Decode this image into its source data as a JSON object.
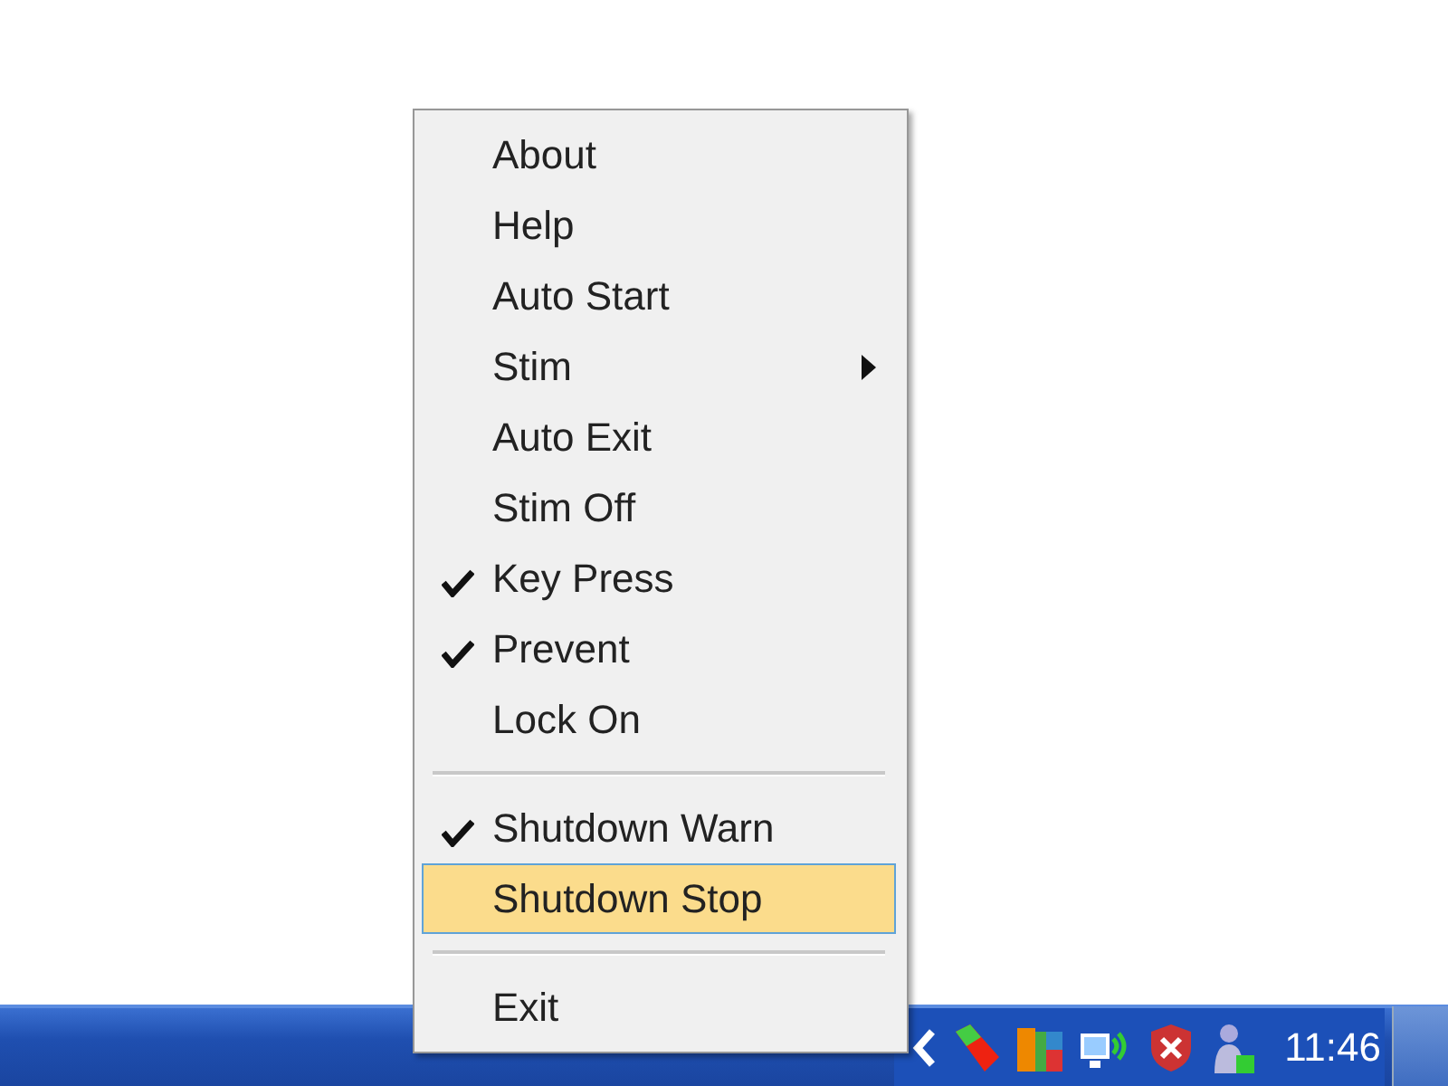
{
  "menu": {
    "items": [
      {
        "kind": "item",
        "label": "About",
        "checked": false,
        "selected": false
      },
      {
        "kind": "item",
        "label": "Help",
        "checked": false,
        "selected": false
      },
      {
        "kind": "item",
        "label": "Auto Start",
        "checked": false,
        "selected": false
      },
      {
        "kind": "submenu",
        "label": "Stim",
        "checked": false,
        "selected": false
      },
      {
        "kind": "item",
        "label": "Auto Exit",
        "checked": false,
        "selected": false
      },
      {
        "kind": "item",
        "label": "Stim Off",
        "checked": false,
        "selected": false
      },
      {
        "kind": "item",
        "label": "Key Press",
        "checked": true,
        "selected": false
      },
      {
        "kind": "item",
        "label": "Prevent",
        "checked": true,
        "selected": false
      },
      {
        "kind": "item",
        "label": "Lock On",
        "checked": false,
        "selected": false
      },
      {
        "kind": "separator"
      },
      {
        "kind": "item",
        "label": "Shutdown Warn",
        "checked": true,
        "selected": false
      },
      {
        "kind": "item",
        "label": "Shutdown Stop",
        "checked": false,
        "selected": true
      },
      {
        "kind": "separator"
      },
      {
        "kind": "item",
        "label": "Exit",
        "checked": false,
        "selected": false
      }
    ]
  },
  "taskbar": {
    "clock": "11:46"
  }
}
